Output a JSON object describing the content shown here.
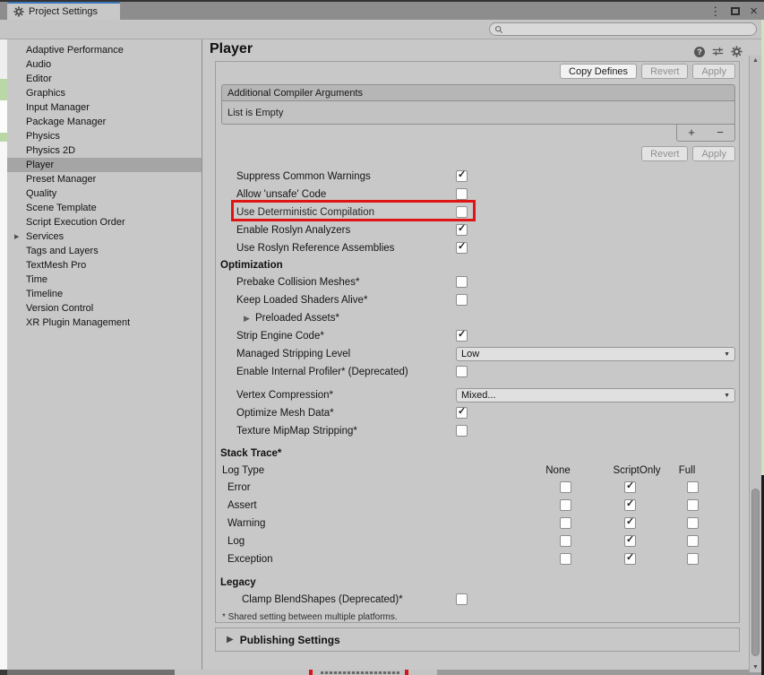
{
  "window": {
    "tab_title": "Project Settings"
  },
  "icons": {
    "kebab": "⋮",
    "close": "×",
    "help": "?",
    "check": "✓",
    "dropdown_arrow": "▼",
    "foldout": "▶",
    "scroll_up": "▲",
    "scroll_down": "▼",
    "add": "+",
    "remove": "−"
  },
  "search": {
    "placeholder": "",
    "value": ""
  },
  "sidebar": {
    "items": [
      {
        "label": "Adaptive Performance",
        "selected": false,
        "arrow": false
      },
      {
        "label": "Audio",
        "selected": false,
        "arrow": false
      },
      {
        "label": "Editor",
        "selected": false,
        "arrow": false
      },
      {
        "label": "Graphics",
        "selected": false,
        "arrow": false
      },
      {
        "label": "Input Manager",
        "selected": false,
        "arrow": false
      },
      {
        "label": "Package Manager",
        "selected": false,
        "arrow": false
      },
      {
        "label": "Physics",
        "selected": false,
        "arrow": false
      },
      {
        "label": "Physics 2D",
        "selected": false,
        "arrow": false
      },
      {
        "label": "Player",
        "selected": true,
        "arrow": false
      },
      {
        "label": "Preset Manager",
        "selected": false,
        "arrow": false
      },
      {
        "label": "Quality",
        "selected": false,
        "arrow": false
      },
      {
        "label": "Scene Template",
        "selected": false,
        "arrow": false
      },
      {
        "label": "Script Execution Order",
        "selected": false,
        "arrow": false
      },
      {
        "label": "Services",
        "selected": false,
        "arrow": true
      },
      {
        "label": "Tags and Layers",
        "selected": false,
        "arrow": false
      },
      {
        "label": "TextMesh Pro",
        "selected": false,
        "arrow": false
      },
      {
        "label": "Time",
        "selected": false,
        "arrow": false
      },
      {
        "label": "Timeline",
        "selected": false,
        "arrow": false
      },
      {
        "label": "Version Control",
        "selected": false,
        "arrow": false
      },
      {
        "label": "XR Plugin Management",
        "selected": false,
        "arrow": false
      }
    ]
  },
  "main": {
    "title": "Player",
    "buttons_top": [
      {
        "label": "Copy Defines",
        "enabled": true
      },
      {
        "label": "Revert",
        "enabled": false
      },
      {
        "label": "Apply",
        "enabled": false
      }
    ],
    "compiler_list": {
      "header": "Additional Compiler Arguments",
      "empty_text": "List is Empty"
    },
    "buttons_mid": [
      {
        "label": "Revert",
        "enabled": false
      },
      {
        "label": "Apply",
        "enabled": false
      }
    ],
    "settings": [
      {
        "label": "Suppress Common Warnings",
        "type": "checkbox",
        "checked": true
      },
      {
        "label": "Allow 'unsafe' Code",
        "type": "checkbox",
        "checked": false
      },
      {
        "label": "Use Deterministic Compilation",
        "type": "checkbox",
        "checked": false,
        "highlight": true
      },
      {
        "label": "Enable Roslyn Analyzers",
        "type": "checkbox",
        "checked": true
      },
      {
        "label": "Use Roslyn Reference Assemblies",
        "type": "checkbox",
        "checked": true
      }
    ],
    "optimization": {
      "header": "Optimization",
      "rows": [
        {
          "label": "Prebake Collision Meshes*",
          "type": "checkbox",
          "checked": false
        },
        {
          "label": "Keep Loaded Shaders Alive*",
          "type": "checkbox",
          "checked": false
        },
        {
          "label": "Preloaded Assets*",
          "type": "foldout"
        },
        {
          "label": "Strip Engine Code*",
          "type": "checkbox",
          "checked": true
        },
        {
          "label": "Managed Stripping Level",
          "type": "dropdown",
          "value": "Low"
        },
        {
          "label": "Enable Internal Profiler* (Deprecated)",
          "type": "checkbox",
          "checked": false
        }
      ],
      "rows2": [
        {
          "label": "Vertex Compression*",
          "type": "dropdown",
          "value": "Mixed..."
        },
        {
          "label": "Optimize Mesh Data*",
          "type": "checkbox",
          "checked": true
        },
        {
          "label": "Texture MipMap Stripping*",
          "type": "checkbox",
          "checked": false
        }
      ]
    },
    "stack_trace": {
      "header": "Stack Trace*",
      "row_label": "Log Type",
      "columns": [
        "None",
        "ScriptOnly",
        "Full"
      ],
      "rows": [
        {
          "label": "Error",
          "values": [
            false,
            true,
            false
          ]
        },
        {
          "label": "Assert",
          "values": [
            false,
            true,
            false
          ]
        },
        {
          "label": "Warning",
          "values": [
            false,
            true,
            false
          ]
        },
        {
          "label": "Log",
          "values": [
            false,
            true,
            false
          ]
        },
        {
          "label": "Exception",
          "values": [
            false,
            true,
            false
          ]
        }
      ]
    },
    "legacy": {
      "header": "Legacy",
      "rows": [
        {
          "label": "Clamp BlendShapes (Deprecated)*",
          "type": "checkbox",
          "checked": false
        }
      ]
    },
    "footnote": "* Shared setting between multiple platforms.",
    "publishing_label": "Publishing Settings"
  },
  "colors": {
    "annotation_red": "#df1414",
    "tab_accent": "#3d76b9",
    "panel_gray": "#c8c8c8",
    "titlebar_gray": "#8d8d8d"
  }
}
